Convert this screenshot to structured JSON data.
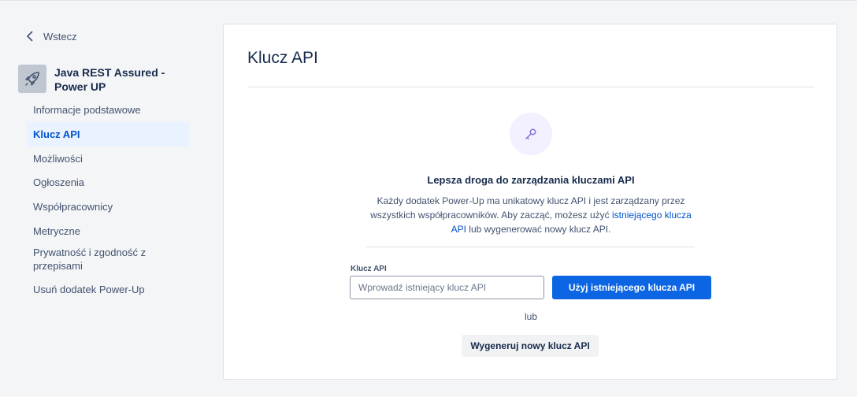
{
  "sidebar": {
    "back_label": "Wstecz",
    "app_name": "Java REST Assured - Power UP",
    "app_icon": "rocket-icon",
    "items": [
      {
        "label": "Informacje podstawowe",
        "active": false
      },
      {
        "label": "Klucz API",
        "active": true
      },
      {
        "label": "Możliwości",
        "active": false
      },
      {
        "label": "Ogłoszenia",
        "active": false
      },
      {
        "label": "Współpracownicy",
        "active": false
      },
      {
        "label": "Metryczne",
        "active": false
      },
      {
        "label": "Prywatność i zgodność z przepisami",
        "active": false
      },
      {
        "label": "Usuń dodatek Power-Up",
        "active": false
      }
    ]
  },
  "main": {
    "title": "Klucz API",
    "icon": "key-icon",
    "heading": "Lepsza droga do zarządzania kluczami API",
    "description_part1": "Każdy dodatek Power-Up ma unikatowy klucz API i jest zarządzany przez wszystkich współpracowników. Aby zacząć, możesz użyć ",
    "description_link": "istniejącego klucza API",
    "description_part2": " lub wygenerować nowy klucz API.",
    "field_label": "Klucz API",
    "field_value": "",
    "field_placeholder": "Wprowadź istniejący klucz API",
    "use_existing_button": "Użyj istniejącego klucza API",
    "or_text": "lub",
    "generate_button": "Wygeneruj nowy klucz API"
  },
  "colors": {
    "primary": "#0c66e4",
    "link": "#0052cc",
    "active_nav_bg": "#e9f2ff",
    "icon_circle_bg": "#f3f0ff",
    "key_icon": "#8270db"
  }
}
